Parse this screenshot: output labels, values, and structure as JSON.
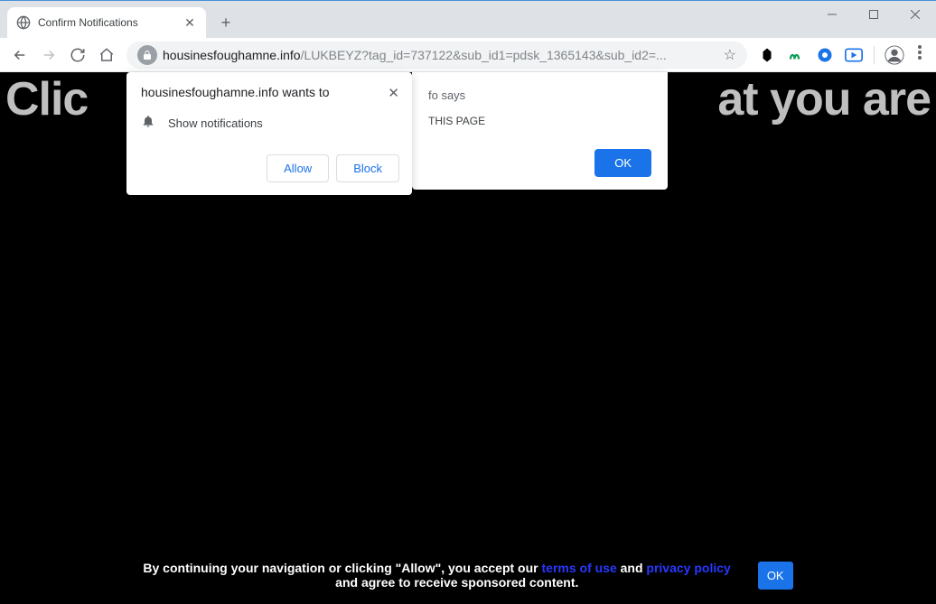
{
  "window": {
    "tab": {
      "title": "Confirm Notifications"
    }
  },
  "address_bar": {
    "domain": "housinesfoughamne.info",
    "path": "/LUKBEYZ?tag_id=737122&sub_id1=pdsk_1365143&sub_id2=..."
  },
  "page": {
    "big_text_left": "Clic",
    "big_text_mid": "at you are"
  },
  "perm_dialog": {
    "title": "housinesfoughamne.info wants to",
    "label": "Show notifications",
    "allow": "Allow",
    "block": "Block"
  },
  "alert_dialog": {
    "title_suffix": "fo says",
    "msg_suffix": "THIS PAGE",
    "ok": "OK"
  },
  "consent": {
    "part1": "By continuing your navigation or clicking \"Allow\", you accept our ",
    "link1": "terms of use",
    "part2": " and ",
    "link2": "privacy policy",
    "part3": " and agree to receive sponsored content.",
    "ok": "OK"
  }
}
